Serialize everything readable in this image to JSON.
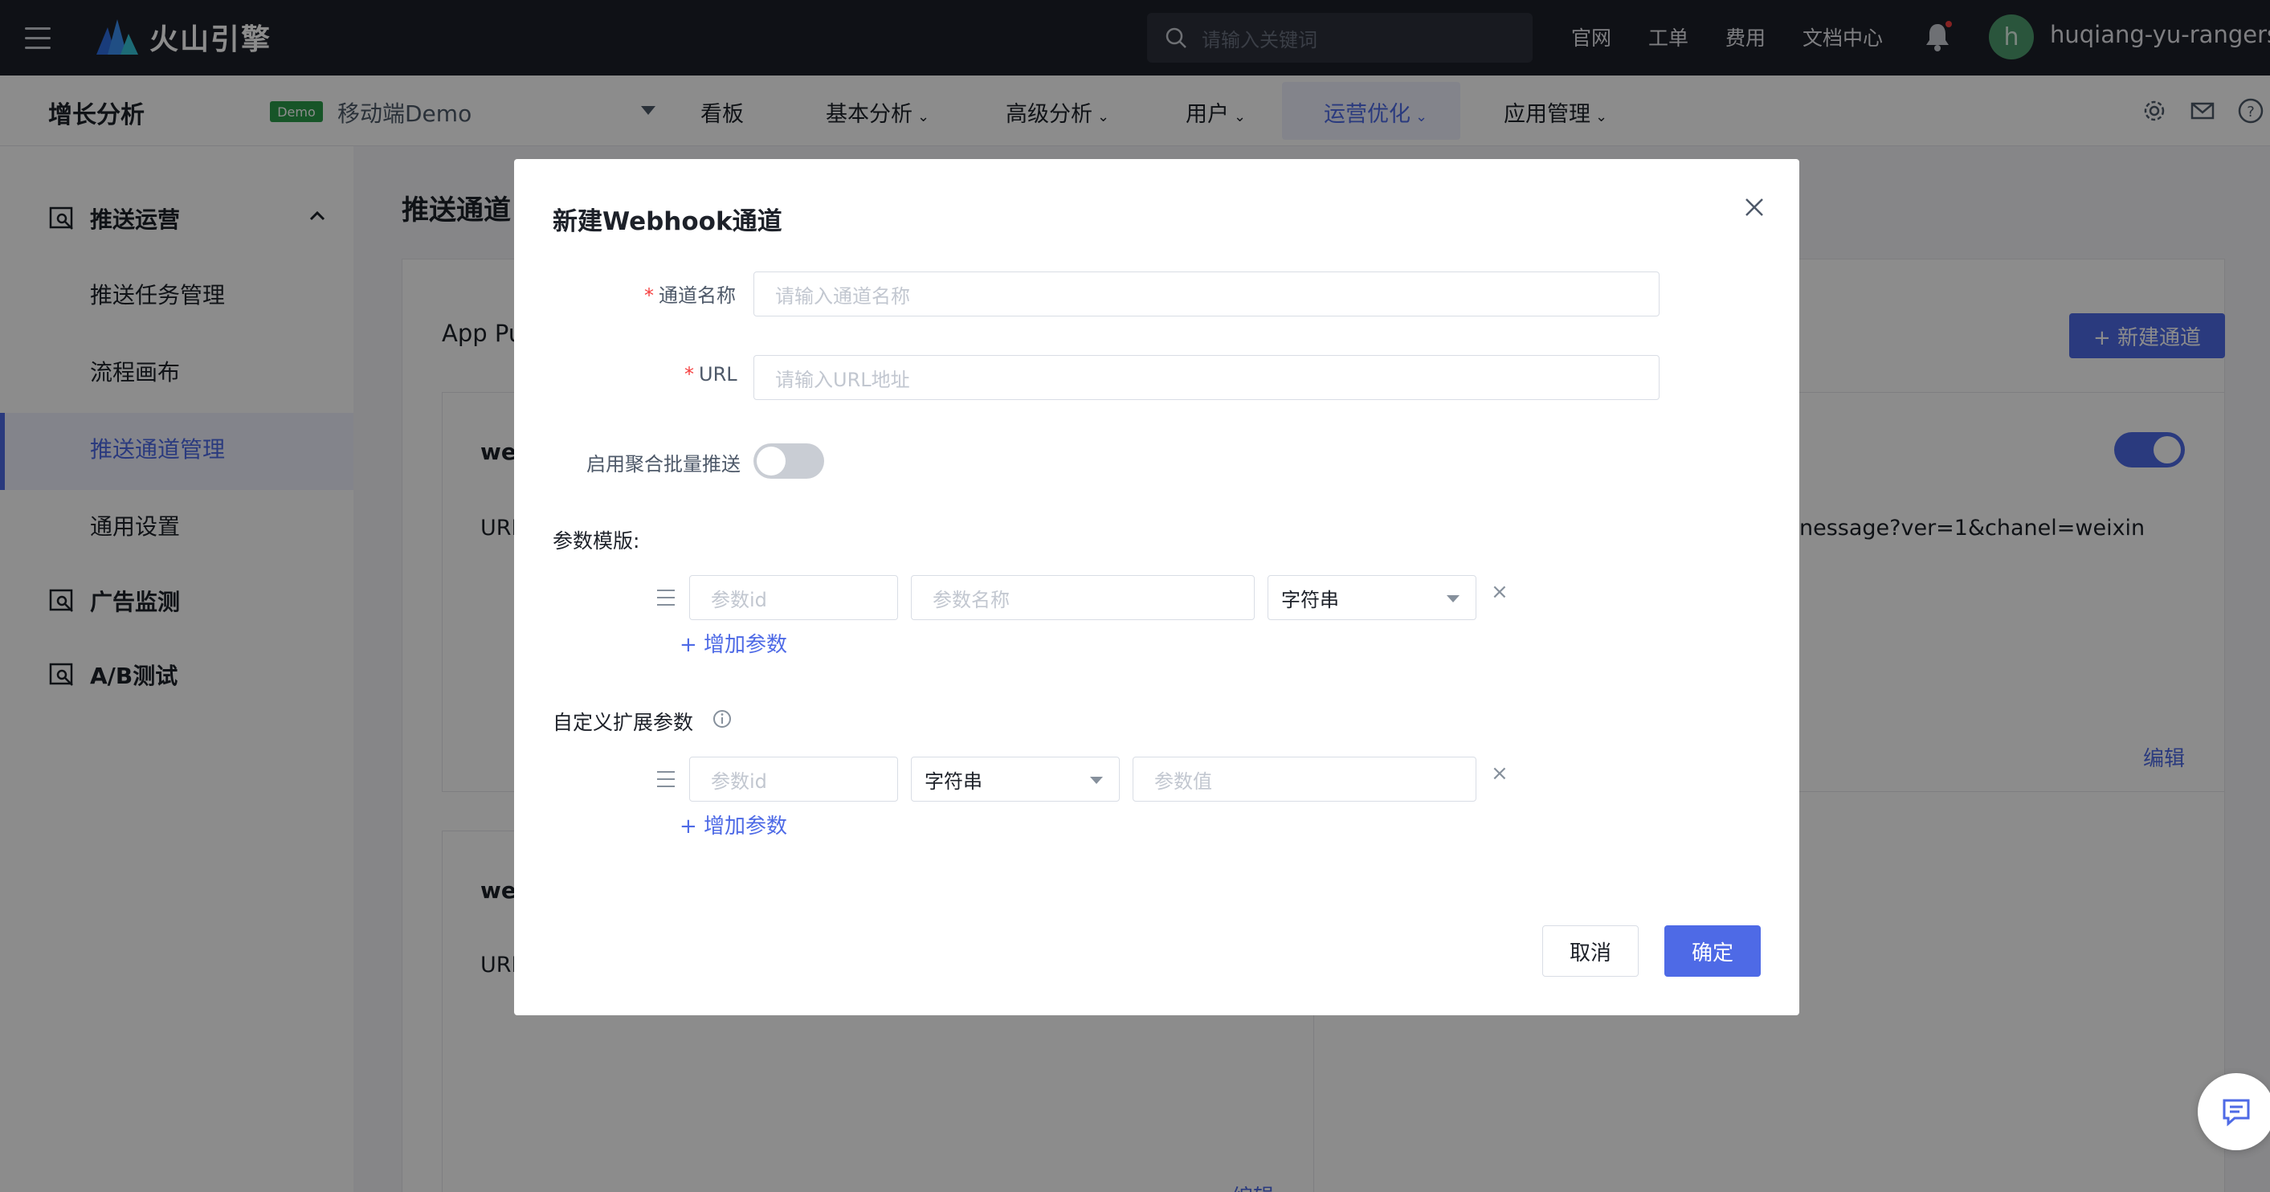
{
  "topbar": {
    "brand": "火山引擎",
    "search_placeholder": "请输入关键词",
    "links": [
      "官网",
      "工单",
      "费用",
      "文档中心"
    ],
    "avatar_letter": "h",
    "username": "huqiang-yu-rangers"
  },
  "subnav": {
    "title": "增长分析",
    "demo_badge": "Demo",
    "app_name": "移动端Demo",
    "items": [
      "看板",
      "基本分析",
      "高级分析",
      "用户",
      "运营优化",
      "应用管理"
    ],
    "active_item": "运营优化"
  },
  "sidebar": {
    "group_push": "推送运营",
    "items": [
      "推送任务管理",
      "流程画布",
      "推送通道管理",
      "通用设置"
    ],
    "active_item": "推送通道管理",
    "group_ad": "广告监测",
    "group_ab": "A/B测试"
  },
  "main": {
    "title": "推送通道",
    "tab": "App Pu",
    "new_button": "+ 新建通道",
    "card1_name": "we",
    "card1_url_prefix": "URL",
    "card1_url_suffix": "nessage?ver=1&chanel=weixin",
    "card1_edit": "编辑",
    "card2_name": "we",
    "card2_url_prefix": "URL",
    "card2_edit": "编辑"
  },
  "modal": {
    "title": "新建Webhook通道",
    "channel_name_label": "通道名称",
    "channel_name_placeholder": "请输入通道名称",
    "url_label": "URL",
    "url_placeholder": "请输入URL地址",
    "batch_label": "启用聚合批量推送",
    "batch_enabled": false,
    "param_template_label": "参数模版:",
    "param_id_placeholder": "参数id",
    "param_name_placeholder": "参数名称",
    "type_value": "字符串",
    "add_param": "+ 增加参数",
    "custom_label": "自定义扩展参数",
    "custom_id_placeholder": "参数id",
    "custom_type_value": "字符串",
    "custom_value_placeholder": "参数值",
    "remove_symbol": "×",
    "cancel": "取消",
    "confirm": "确定"
  },
  "colors": {
    "accent": "#4e6ae6",
    "topbar_bg": "#1d2029",
    "required": "#f53f3f"
  }
}
